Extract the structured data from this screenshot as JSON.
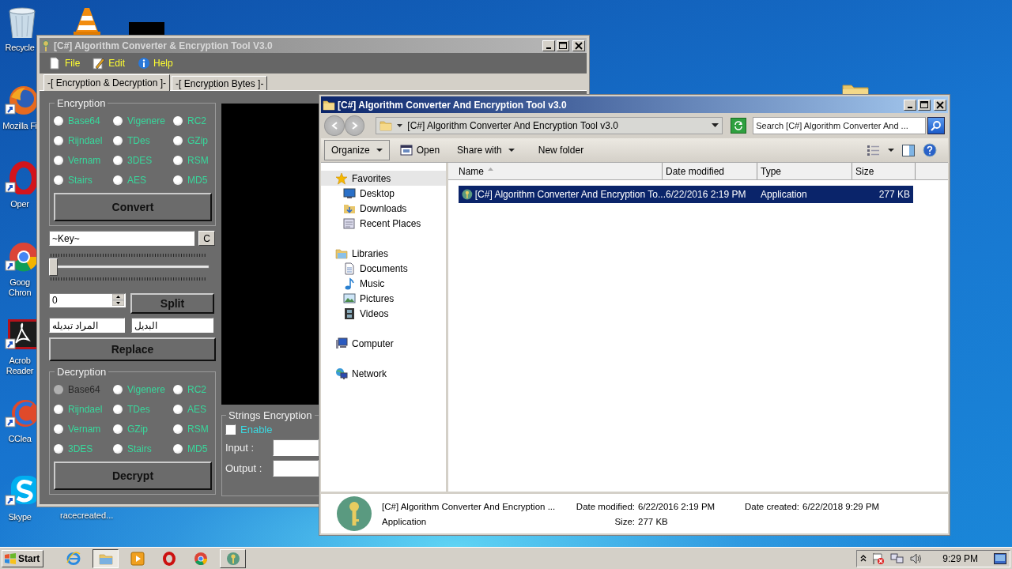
{
  "desktop": {
    "icons": [
      {
        "kind": "recycle",
        "label_lines": [
          "Recycle"
        ]
      },
      {
        "kind": "firefox",
        "label_lines": [
          "Mozilla Fi"
        ]
      },
      {
        "kind": "opera",
        "label_lines": [
          "Oper"
        ]
      },
      {
        "kind": "chrome",
        "label_lines": [
          "Goog",
          "Chron"
        ]
      },
      {
        "kind": "acrobat",
        "label_lines": [
          "Acrob",
          "Reader"
        ]
      },
      {
        "kind": "ccleaner",
        "label_lines": [
          "CClea"
        ]
      },
      {
        "kind": "skype",
        "label_lines": [
          "Skype"
        ]
      }
    ],
    "extra_icons": [
      {
        "kind": "vlc"
      },
      {
        "kind": "dark"
      },
      {
        "kind": "folder"
      }
    ],
    "extra_labels": [
      "racecreated..."
    ]
  },
  "app_window": {
    "title": "[C#] Algorithm Converter & Encryption Tool V3.0",
    "menu": [
      {
        "kind": "file",
        "label": "File"
      },
      {
        "kind": "edit",
        "label": "Edit"
      },
      {
        "kind": "help",
        "label": "Help"
      }
    ],
    "tabs": [
      {
        "label": "-[ Encryption & Decryption ]-",
        "selected": true
      },
      {
        "label": "-[ Encryption Bytes ]-",
        "selected": false
      }
    ],
    "encryption": {
      "title": "Encryption",
      "button": "Convert",
      "options": [
        {
          "label": "Base64",
          "selected": false,
          "disabled": false
        },
        {
          "label": "Vigenere",
          "selected": false,
          "disabled": false
        },
        {
          "label": "RC2",
          "selected": false,
          "disabled": false
        },
        {
          "label": "Rijndael",
          "selected": false,
          "disabled": false
        },
        {
          "label": "TDes",
          "selected": false,
          "disabled": false
        },
        {
          "label": "GZip",
          "selected": false,
          "disabled": false
        },
        {
          "label": "Vernam",
          "selected": false,
          "disabled": false
        },
        {
          "label": "3DES",
          "selected": false,
          "disabled": false
        },
        {
          "label": "RSM",
          "selected": false,
          "disabled": false
        },
        {
          "label": "Stairs",
          "selected": false,
          "disabled": false
        },
        {
          "label": "AES",
          "selected": false,
          "disabled": false
        },
        {
          "label": "MD5",
          "selected": false,
          "disabled": false
        }
      ]
    },
    "key_field": {
      "value": "~Key~"
    },
    "clear_button": "C",
    "slider": {
      "level": 0
    },
    "split_count": {
      "value": "0"
    },
    "split_button": "Split",
    "find_field": {
      "value": "المراد تبديله"
    },
    "replace_field": {
      "value": "البديل"
    },
    "replace_button": "Replace",
    "decryption": {
      "title": "Decryption",
      "button": "Decrypt",
      "options": [
        {
          "label": "Base64",
          "selected": false,
          "disabled": true
        },
        {
          "label": "Vigenere",
          "selected": false,
          "disabled": false
        },
        {
          "label": "RC2",
          "selected": false,
          "disabled": false
        },
        {
          "label": "Rijndael",
          "selected": false,
          "disabled": false
        },
        {
          "label": "TDes",
          "selected": false,
          "disabled": false
        },
        {
          "label": "AES",
          "selected": false,
          "disabled": false
        },
        {
          "label": "Vernam",
          "selected": false,
          "disabled": false
        },
        {
          "label": "GZip",
          "selected": false,
          "disabled": false
        },
        {
          "label": "RSM",
          "selected": false,
          "disabled": false
        },
        {
          "label": "3DES",
          "selected": false,
          "disabled": false
        },
        {
          "label": "Stairs",
          "selected": false,
          "disabled": false
        },
        {
          "label": "MD5",
          "selected": false,
          "disabled": false
        }
      ]
    },
    "strings_encryption": {
      "title": "Strings Encryption",
      "enable": {
        "label": "Enable",
        "checked": false
      },
      "input_label": "Input :",
      "output_label": "Output :"
    }
  },
  "explorer": {
    "title": "[C#] Algorithm Converter And Encryption Tool v3.0",
    "address": "[C#] Algorithm Converter And Encryption Tool v3.0",
    "search": {
      "placeholder": "Search [C#] Algorithm Converter And ..."
    },
    "toolbar": [
      {
        "kind": "menu",
        "label": "Organize"
      },
      {
        "kind": "open",
        "label": "Open"
      },
      {
        "kind": "menu-flat",
        "label": "Share with"
      },
      {
        "kind": "plain",
        "label": "New folder"
      }
    ],
    "nav": [
      {
        "kind": "star",
        "label": "Favorites",
        "selected": true,
        "children": [
          {
            "kind": "desktop",
            "label": "Desktop",
            "selected": false
          },
          {
            "kind": "downloads",
            "label": "Downloads",
            "selected": false
          },
          {
            "kind": "recent",
            "label": "Recent Places",
            "selected": false
          }
        ]
      },
      {
        "kind": "libraries",
        "label": "Libraries",
        "selected": false,
        "children": [
          {
            "kind": "documents",
            "label": "Documents",
            "selected": false
          },
          {
            "kind": "music",
            "label": "Music",
            "selected": false
          },
          {
            "kind": "pictures",
            "label": "Pictures",
            "selected": false
          },
          {
            "kind": "videos",
            "label": "Videos",
            "selected": false
          }
        ]
      },
      {
        "kind": "computer",
        "label": "Computer",
        "selected": false
      },
      {
        "kind": "network",
        "label": "Network",
        "selected": false
      }
    ],
    "columns": [
      "Name",
      "Date modified",
      "Type",
      "Size"
    ],
    "rows": [
      {
        "name": "[C#] Algorithm Converter And Encryption To...",
        "date_modified": "6/22/2016 2:19 PM",
        "type": "Application",
        "size": "277 KB",
        "selected": true
      }
    ],
    "details": {
      "name": "[C#] Algorithm Converter And Encryption ...",
      "type": "Application",
      "modified_label": "Date modified:",
      "modified": "6/22/2016 2:19 PM",
      "size_label": "Size:",
      "size": "277 KB",
      "created_label": "Date created:",
      "created": "6/22/2018 9:29 PM"
    }
  },
  "taskbar": {
    "start": "Start",
    "items": [
      {
        "kind": "ie",
        "open_window": false,
        "selected": false
      },
      {
        "kind": "folder",
        "open_window": true,
        "selected": true
      },
      {
        "kind": "media",
        "open_window": false,
        "selected": false
      },
      {
        "kind": "red-o",
        "open_window": false,
        "selected": false
      },
      {
        "kind": "chrome",
        "open_window": false,
        "selected": false
      },
      {
        "kind": "key",
        "open_window": true,
        "selected": false
      }
    ],
    "clock": "9:29 PM"
  }
}
